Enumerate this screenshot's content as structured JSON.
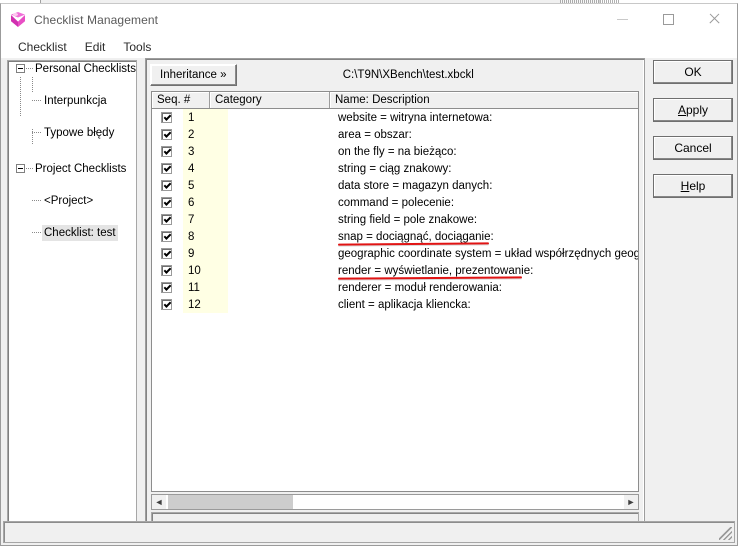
{
  "window": {
    "title": "Checklist Management",
    "icon": "cube-icon",
    "controls": {
      "minimize": "minimize-icon",
      "maximize": "maximize-icon",
      "close": "close-icon"
    }
  },
  "menubar": {
    "items": [
      {
        "label": "Checklist"
      },
      {
        "label": "Edit"
      },
      {
        "label": "Tools"
      }
    ]
  },
  "tree": {
    "nodes": [
      {
        "label": "Personal Checklists",
        "level": 0,
        "expanded": true,
        "selected": false
      },
      {
        "label": "Interpunkcja",
        "level": 1,
        "expanded": false,
        "selected": false
      },
      {
        "label": "Typowe błędy",
        "level": 1,
        "expanded": false,
        "selected": false
      },
      {
        "label": "Project Checklists",
        "level": 0,
        "expanded": true,
        "selected": false
      },
      {
        "label": "<Project>",
        "level": 1,
        "expanded": false,
        "selected": false
      },
      {
        "label": "Checklist: test",
        "level": 1,
        "expanded": false,
        "selected": true
      }
    ]
  },
  "toolbar": {
    "inheritance_label": "Inheritance »",
    "path": "C:\\T9N\\XBench\\test.xbckl"
  },
  "grid": {
    "columns": [
      "Seq. #",
      "Category",
      "Name: Description"
    ],
    "rows": [
      {
        "checked": true,
        "seq": "1",
        "category": "",
        "name": "website = witryna internetowa:"
      },
      {
        "checked": true,
        "seq": "2",
        "category": "",
        "name": "area = obszar:"
      },
      {
        "checked": true,
        "seq": "3",
        "category": "",
        "name": "on the fly = na bieżąco:"
      },
      {
        "checked": true,
        "seq": "4",
        "category": "",
        "name": "string = ciąg znakowy:"
      },
      {
        "checked": true,
        "seq": "5",
        "category": "",
        "name": "data store = magazyn danych:"
      },
      {
        "checked": true,
        "seq": "6",
        "category": "",
        "name": "command = polecenie:"
      },
      {
        "checked": true,
        "seq": "7",
        "category": "",
        "name": "string field = pole znakowe:"
      },
      {
        "checked": true,
        "seq": "8",
        "category": "",
        "name": "snap = dociągnąć, dociąganie:"
      },
      {
        "checked": true,
        "seq": "9",
        "category": "",
        "name": "geographic coordinate system = układ współrzędnych geograficz"
      },
      {
        "checked": true,
        "seq": "10",
        "category": "",
        "name": "render = wyświetlanie, prezentowanie:"
      },
      {
        "checked": true,
        "seq": "11",
        "category": "",
        "name": "renderer = moduł renderowania:"
      },
      {
        "checked": true,
        "seq": "12",
        "category": "",
        "name": "client = aplikacja kliencka:"
      }
    ],
    "annotations": [
      {
        "type": "red-underline",
        "row": 8
      },
      {
        "type": "red-underline",
        "row": 10
      }
    ],
    "scrollbar": {
      "left_arrow": "chevron-left-icon",
      "right_arrow": "chevron-right-icon"
    }
  },
  "buttons": [
    {
      "label": "OK",
      "accel_index": -1
    },
    {
      "label": "Apply",
      "accel_index": 0
    },
    {
      "label": "Cancel",
      "accel_index": -1
    },
    {
      "label": "Help",
      "accel_index": 0
    }
  ],
  "colors": {
    "seq_band": "#ffffe4",
    "annotation_red": "#e11414",
    "selection": "#e4e4e4",
    "face": "#f0f0f0"
  }
}
